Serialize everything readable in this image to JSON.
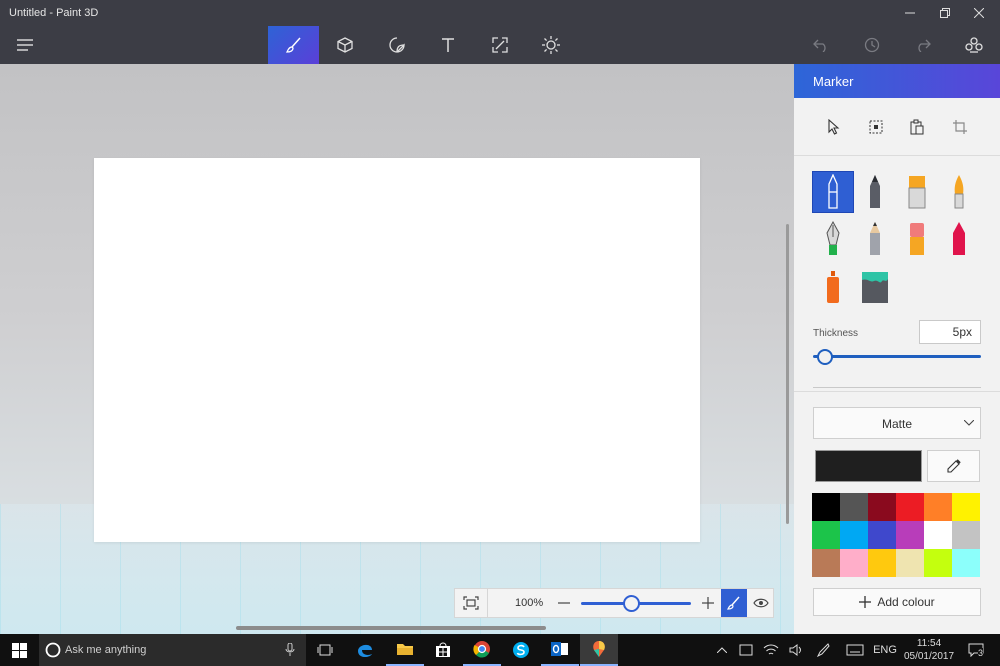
{
  "window": {
    "title": "Untitled - Paint 3D"
  },
  "toolbar": {
    "tools": [
      "brushes-icon",
      "3d-objects-icon",
      "stickers-icon",
      "text-icon",
      "canvas-icon",
      "effects-icon"
    ],
    "active_tool": "brushes"
  },
  "panel": {
    "title": "Marker",
    "thickness_label": "Thickness",
    "thickness_value": "5px",
    "thickness_level": 0.07,
    "finish": "Matte",
    "selected_color": "#1f1f1f",
    "palette": [
      "#000000",
      "#555555",
      "#8a0a1e",
      "#ec1c24",
      "#ff7f27",
      "#fff200",
      "#1cc44a",
      "#00a8f3",
      "#3f48cc",
      "#b83dba",
      "#ffffff",
      "#c3c3c3",
      "#b97a57",
      "#ffaec9",
      "#ffc90e",
      "#efe4b0",
      "#c4ff0e",
      "#8cfffb"
    ],
    "add_colour_label": "Add colour"
  },
  "zoom": {
    "value": "100%",
    "level": 0.45
  },
  "taskbar": {
    "search_placeholder": "Ask me anything",
    "language": "ENG",
    "time": "11:54",
    "date": "05/01/2017",
    "notifications": "3"
  }
}
